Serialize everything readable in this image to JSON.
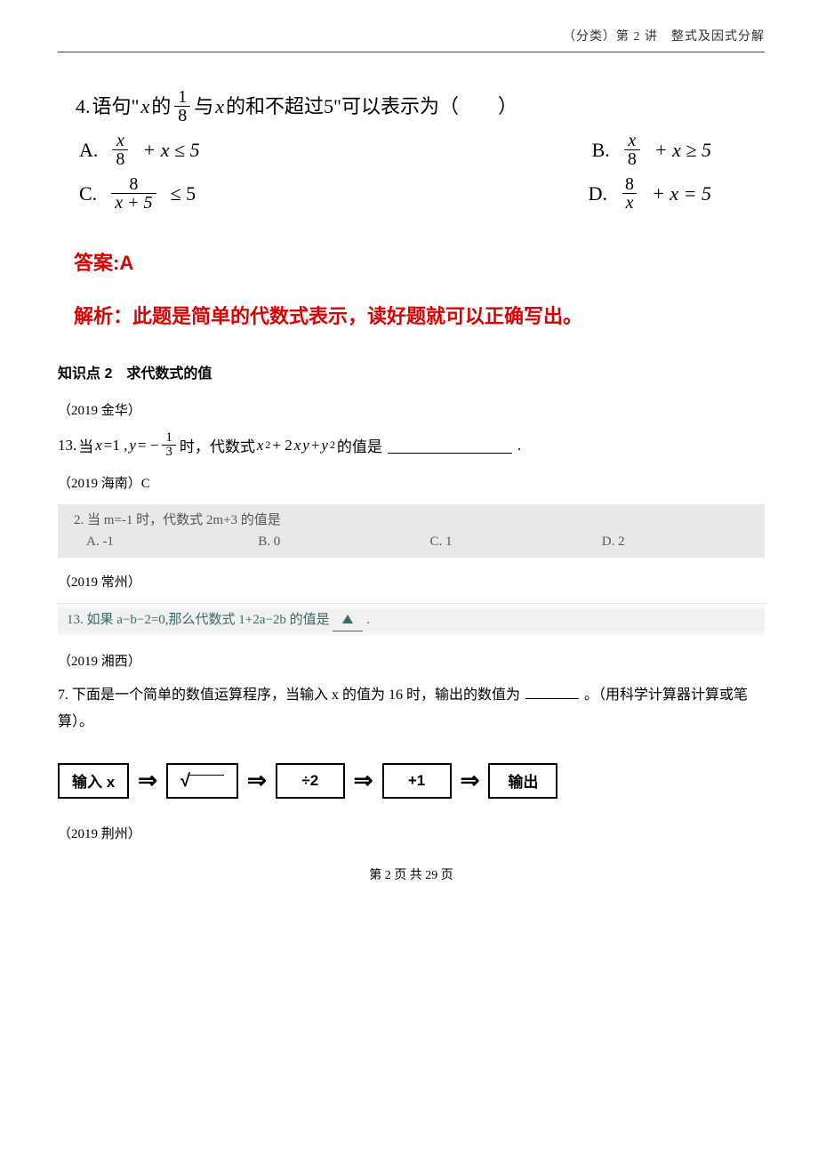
{
  "header": {
    "right": "（分类）第 2 讲　整式及因式分解"
  },
  "q4": {
    "num": "4.",
    "stem_a": "语句\"",
    "stem_b": "的",
    "frac_num": "1",
    "frac_den": "8",
    "stem_c": "与",
    "stem_d": "的和不超过5\"可以表示为（　　）",
    "var_x": "x",
    "choices": {
      "A": {
        "label": "A.",
        "numer": "x",
        "denom": "8",
        "tail": "+ x ≤ 5"
      },
      "B": {
        "label": "B.",
        "numer": "x",
        "denom": "8",
        "tail": "+ x ≥ 5"
      },
      "C": {
        "label": "C.",
        "numer": "8",
        "denom": "x + 5",
        "tail": "≤ 5"
      },
      "D": {
        "label": "D.",
        "numer": "8",
        "denom": "x",
        "tail": "+ x = 5"
      }
    }
  },
  "answer": "答案:A",
  "explain": "解析：此题是简单的代数式表示，读好题就可以正确写出。",
  "kz2": "知识点 2　求代数式的值",
  "src_jinhua": "（2019 金华）",
  "q13": {
    "num": "13.",
    "a": "当 ",
    "x": "x",
    "eq1": "=1 ,",
    "y": "y",
    "eq2": "= − ",
    "frac_num": "1",
    "frac_den": "3",
    "mid": "时，代数式 ",
    "expr_x2": "x",
    "expr_plus1": " + 2",
    "expr_xy_x": "x",
    "expr_xy_y": "y",
    "expr_plus2": " + ",
    "expr_y2": "y",
    "tail": " 的值是",
    "end": "."
  },
  "src_hainan": "（2019 海南）C",
  "scan1": {
    "stem": "2. 当 m=-1 时，代数式 2m+3 的值是",
    "A": "A. -1",
    "B": "B. 0",
    "C": "C. 1",
    "D": "D. 2"
  },
  "src_changzhou": "（2019 常州）",
  "scan2": {
    "text_a": "13. 如果 a−b−2=0,那么代数式 1+2a−2b 的值是",
    "text_b": "."
  },
  "src_xiangxi": "（2019 湘西）",
  "q7": {
    "text_a": "7. 下面是一个简单的数值运算程序，当输入 x 的值为 16 时，输出的数值为",
    "text_b": "。（用科学计算器计算或笔算）。"
  },
  "flow": {
    "b1": "输入 x",
    "b3": "÷2",
    "b4": "+1",
    "b5": "输出"
  },
  "src_jingzhou": "（2019 荆州）",
  "footer": "第 2 页 共 29 页"
}
